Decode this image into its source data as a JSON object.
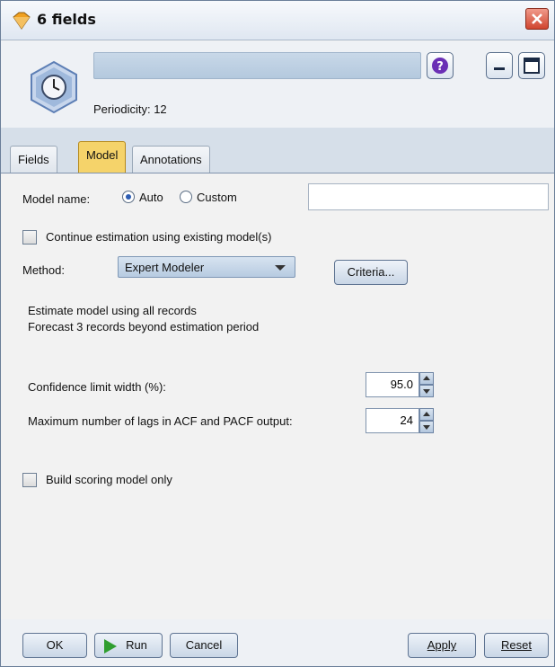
{
  "window": {
    "title": "6 fields",
    "periodicity": "Periodicity: 12"
  },
  "tabs": [
    {
      "label": "Fields",
      "active": false
    },
    {
      "label": "Model",
      "active": true
    },
    {
      "label": "Annotations",
      "active": false
    }
  ],
  "model": {
    "name_label": "Model name:",
    "auto_label": "Auto",
    "custom_label": "Custom",
    "selected": "Auto",
    "custom_value": "",
    "continue_label": "Continue estimation using existing model(s)",
    "continue_checked": false,
    "method_label": "Method:",
    "method_value": "Expert Modeler",
    "criteria_label": "Criteria...",
    "info_line1": "Estimate model using all records",
    "info_line2": "Forecast 3 records beyond estimation period",
    "confidence_label": "Confidence limit width (%):",
    "confidence_value": "95.0",
    "lags_label": "Maximum number of lags in ACF and PACF output:",
    "lags_value": "24",
    "scoring_label": "Build scoring model only",
    "scoring_checked": false
  },
  "footer": {
    "ok_label": "OK",
    "run_label": "Run",
    "cancel_label": "Cancel",
    "apply_label": "Apply",
    "reset_label": "Reset"
  },
  "colors": {
    "active_tab": "#f5d36a",
    "title_close": "#d0452f",
    "run_green": "#2f9e2f"
  }
}
